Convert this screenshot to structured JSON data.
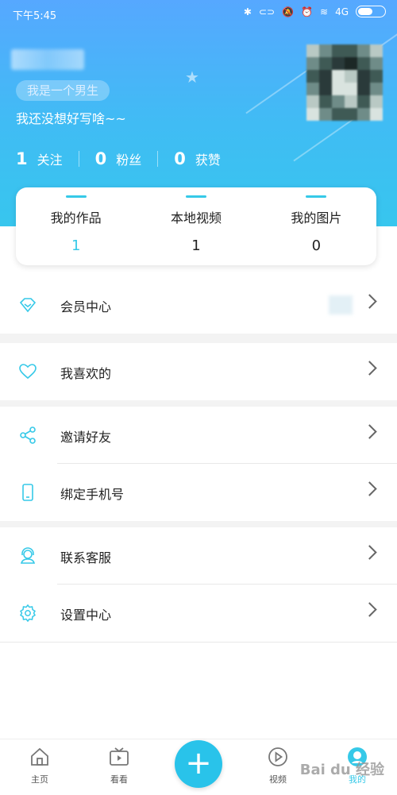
{
  "status": {
    "time": "下午5:45",
    "net_label": "4G"
  },
  "profile": {
    "tag": "我是一个男生",
    "bio": "我还没想好写啥~~",
    "stats": [
      {
        "num": "1",
        "label": "关注"
      },
      {
        "num": "0",
        "label": "粉丝"
      },
      {
        "num": "0",
        "label": "获赞"
      }
    ]
  },
  "works": [
    {
      "label": "我的作品",
      "value": "1"
    },
    {
      "label": "本地视频",
      "value": "1"
    },
    {
      "label": "我的图片",
      "value": "0"
    }
  ],
  "menu": {
    "vip": "会员中心",
    "likes": "我喜欢的",
    "invite": "邀请好友",
    "bind_phone": "绑定手机号",
    "service": "联系客服",
    "settings": "设置中心"
  },
  "tabs": {
    "home": "主页",
    "watch": "看看",
    "video": "视频",
    "mine": "我的"
  },
  "fab": "+",
  "accent": "#36c9e8"
}
